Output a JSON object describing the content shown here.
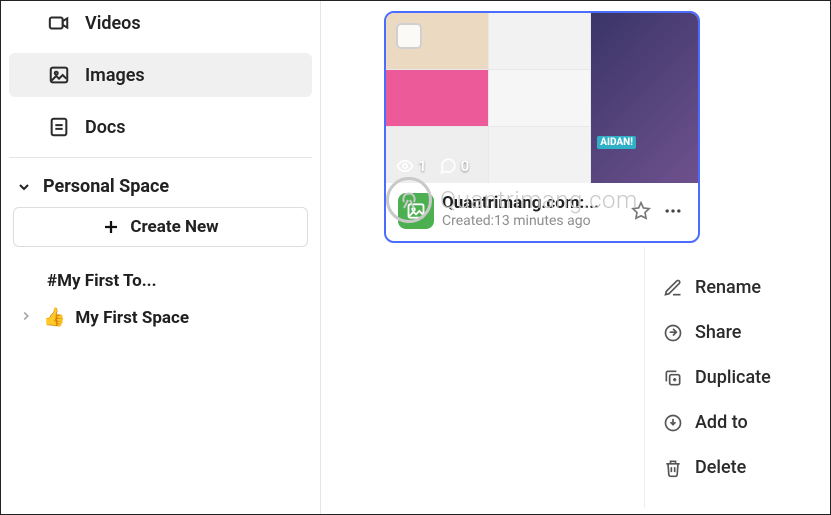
{
  "sidebar": {
    "nav": {
      "videos": "Videos",
      "images": "Images",
      "docs": "Docs"
    },
    "section_label": "Personal Space",
    "create_label": "Create New",
    "space_hash": "#My First To...",
    "space_item": "My First Space"
  },
  "card": {
    "title": "Quantrimang.com:...",
    "created": "Created:13 minutes ago",
    "views": "1",
    "comments": "0"
  },
  "watermark": {
    "brand": "Quantrimang",
    "suffix": ".com"
  },
  "menu": {
    "rename": "Rename",
    "share": "Share",
    "duplicate": "Duplicate",
    "addto": "Add to",
    "delete": "Delete"
  }
}
